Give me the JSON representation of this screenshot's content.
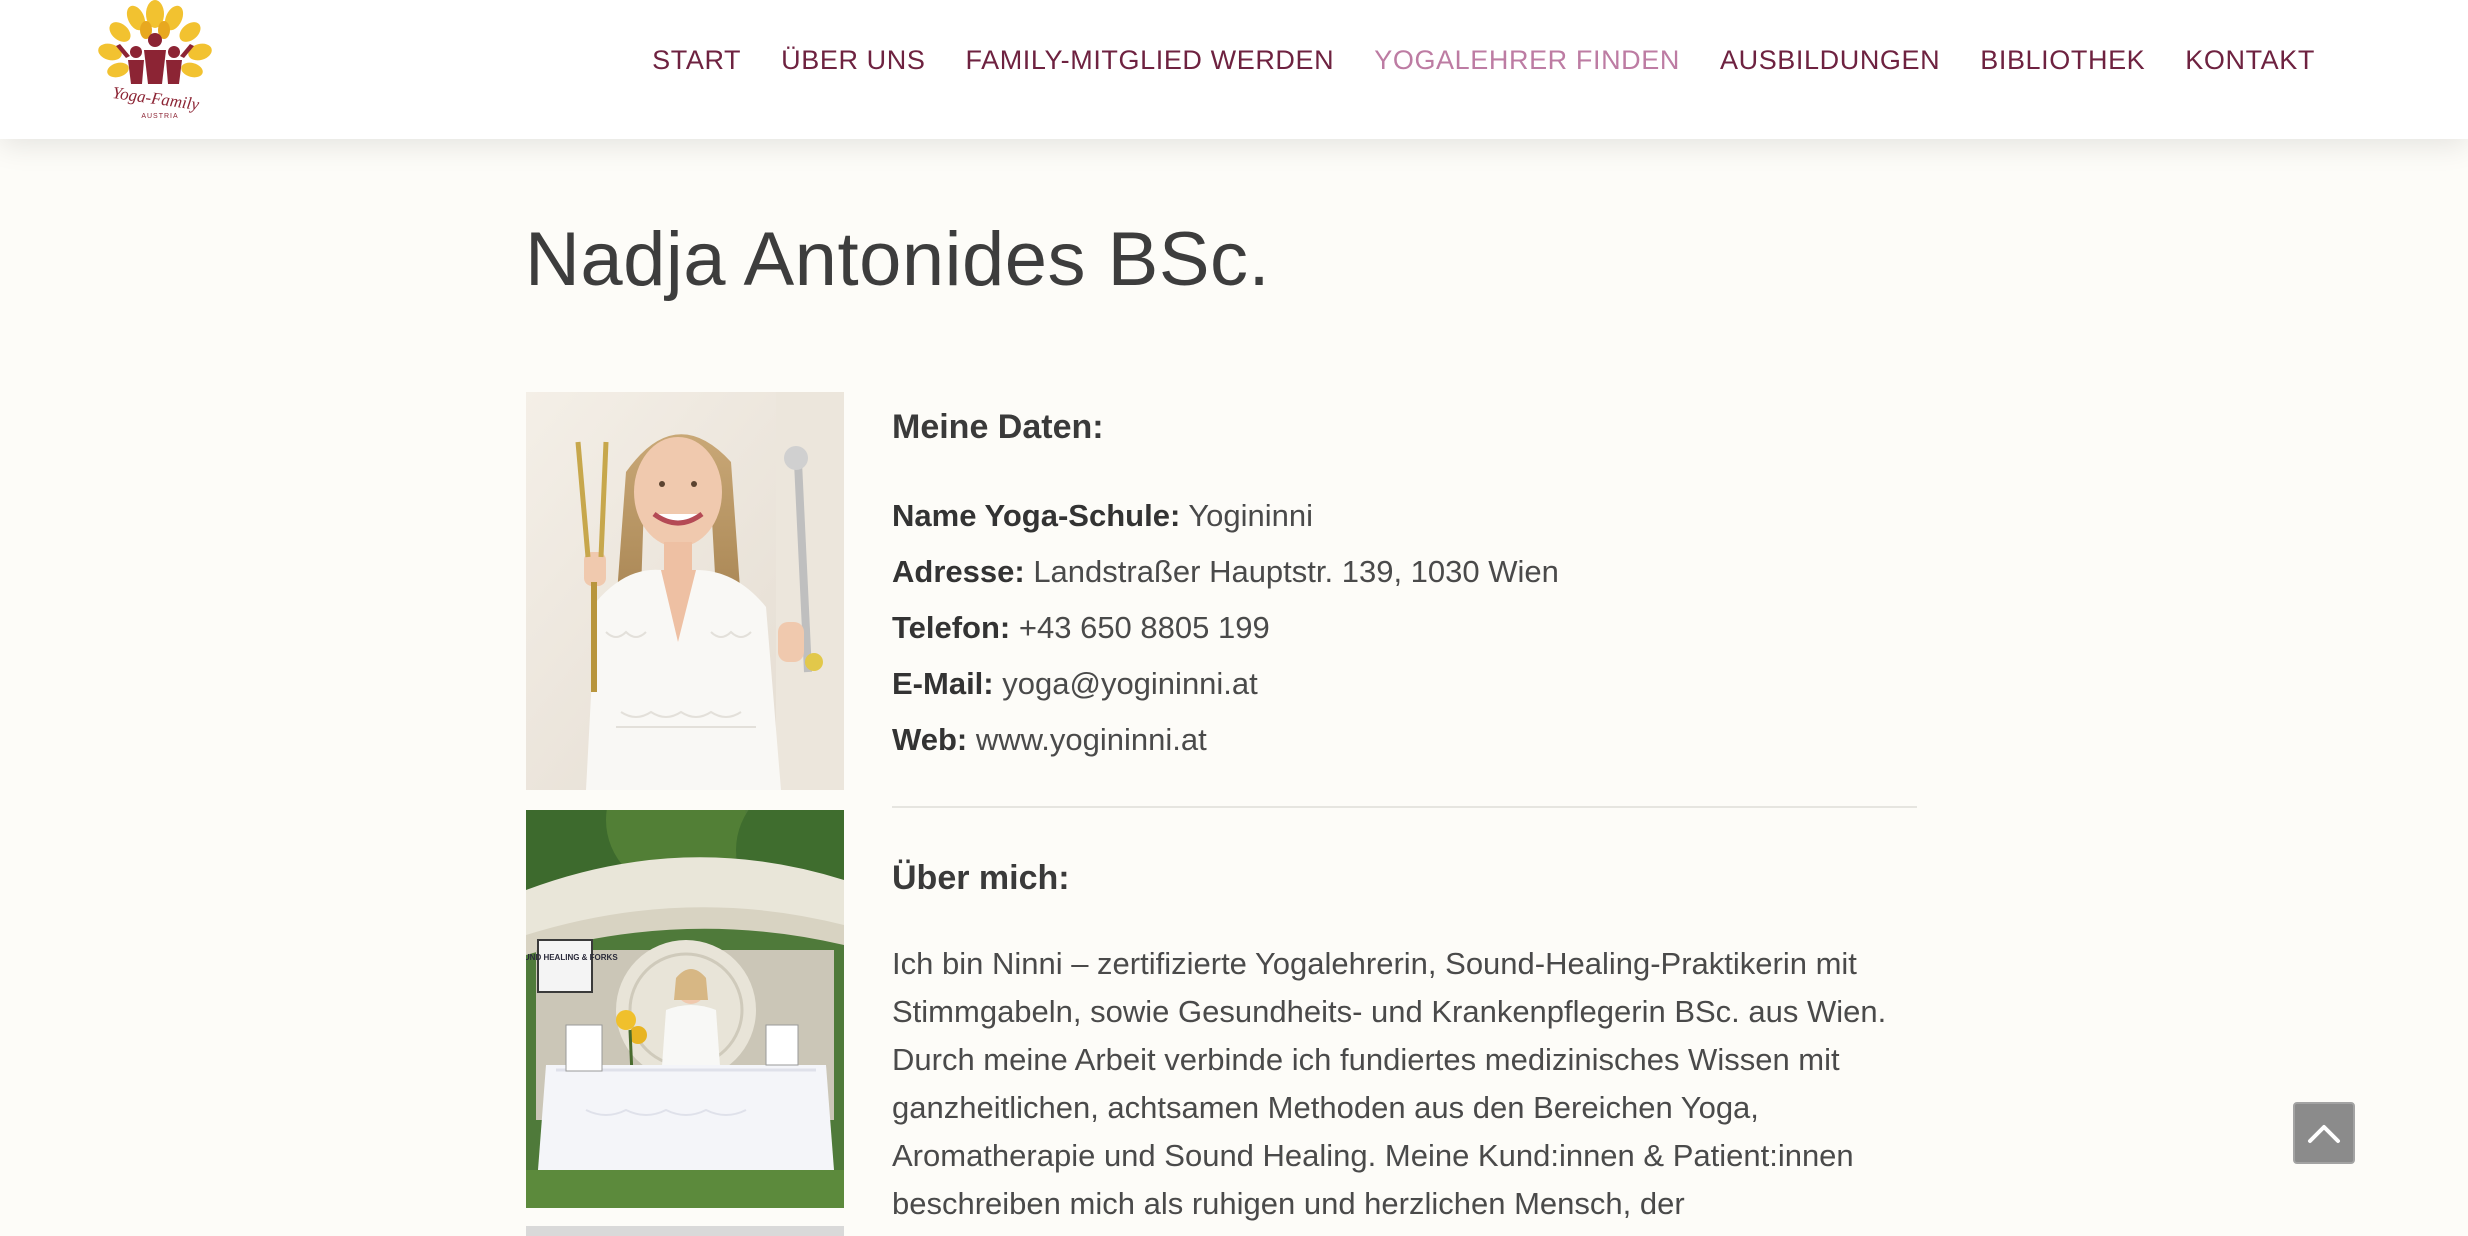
{
  "brand": {
    "logo_text": "Yoga-Family",
    "logo_subtext": "AUSTRIA",
    "accent_color": "#6e2240",
    "active_color": "#bd7ca3"
  },
  "nav": {
    "items": [
      {
        "label": "START",
        "active": false
      },
      {
        "label": "ÜBER UNS",
        "active": false
      },
      {
        "label": "FAMILY-MITGLIED WERDEN",
        "active": false
      },
      {
        "label": "YOGALEHRER FINDEN",
        "active": true
      },
      {
        "label": "AUSBILDUNGEN",
        "active": false
      },
      {
        "label": "BIBLIOTHEK",
        "active": false
      },
      {
        "label": "KONTAKT",
        "active": false
      }
    ]
  },
  "profile": {
    "name": "Nadja Antonides BSc."
  },
  "my_data": {
    "heading": "Meine Daten:",
    "fields": [
      {
        "label": "Name Yoga-Schule:",
        "value": "Yogininni"
      },
      {
        "label": "Adresse:",
        "value": "Landstraßer Hauptstr. 139, 1030 Wien"
      },
      {
        "label": "Telefon:",
        "value": "+43 650 8805 199"
      },
      {
        "label": "E-Mail:",
        "value": "yoga@yogininni.at"
      },
      {
        "label": "Web:",
        "value": "www.yogininni.at"
      }
    ]
  },
  "about": {
    "heading": "Über mich:",
    "text": "Ich bin Ninni – zertifizierte Yogalehrerin, Sound-Healing-Praktikerin mit Stimmgabeln, sowie Gesundheits- und Krankenpflegerin BSc. aus Wien. Durch meine Arbeit verbinde ich fundiertes medizinisches Wissen mit ganzheitlichen, achtsamen Methoden aus den Bereichen Yoga, Aromatherapie und Sound Healing. Meine Kund:innen & Patient:innen beschreiben mich als ruhigen und herzlichen Mensch, der"
  },
  "sign_text": "SOUND HEALING & FORKS",
  "icons": {
    "scroll_top": "chevron-up-icon"
  }
}
